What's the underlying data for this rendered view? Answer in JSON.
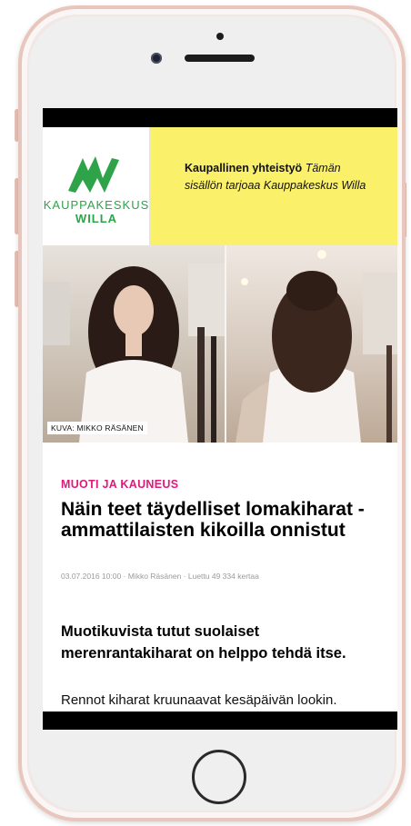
{
  "sponsor": {
    "logo_line1": "KAUPPAKESKUS",
    "logo_line2": "WILLA",
    "label_bold": "Kaupallinen yhteistyö",
    "label_italic": "Tämän sisällön tarjoaa Kauppakeskus Willa"
  },
  "hero": {
    "caption": "KUVA: MIKKO RÄSÄNEN"
  },
  "article": {
    "category": "MUOTI JA KAUNEUS",
    "title": "Näin teet täydelliset lomakiharat - ammattilaisten kikoilla onnistut",
    "meta": "03.07.2016 10:00 ·  Mikko Räsänen  · Luettu 49 334 kertaa",
    "lead": "Muotikuvista tutut suolaiset merenrantakiharat on helppo tehdä itse.",
    "body_first_line": "Rennot kiharat kruunaavat kesäpäivän lookin."
  },
  "colors": {
    "brand_green": "#2fa34a",
    "sponsor_yellow": "#faf06a",
    "category_pink": "#e0197a",
    "phone_frame": "#e9c6bc"
  }
}
